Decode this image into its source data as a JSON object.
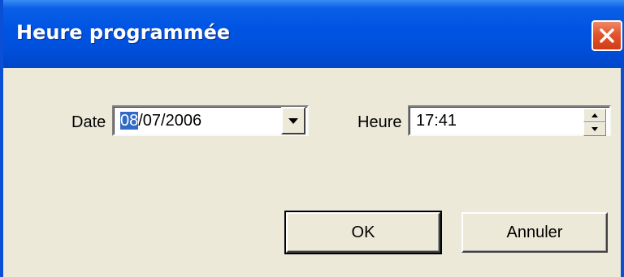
{
  "window": {
    "title": "Heure programmée",
    "close_icon": "close-icon"
  },
  "date": {
    "label": "Date",
    "value_selected": "08",
    "value_rest": "/07/2006",
    "dropdown_icon": "chevron-down-icon"
  },
  "time": {
    "label": "Heure",
    "value": "17:41",
    "spin_up_icon": "arrow-up-icon",
    "spin_down_icon": "arrow-down-icon"
  },
  "buttons": {
    "ok": "OK",
    "cancel": "Annuler"
  },
  "colors": {
    "titlebar": "#0054e3",
    "face": "#ece9d8",
    "selection": "#316ac5",
    "close": "#e2552f"
  }
}
